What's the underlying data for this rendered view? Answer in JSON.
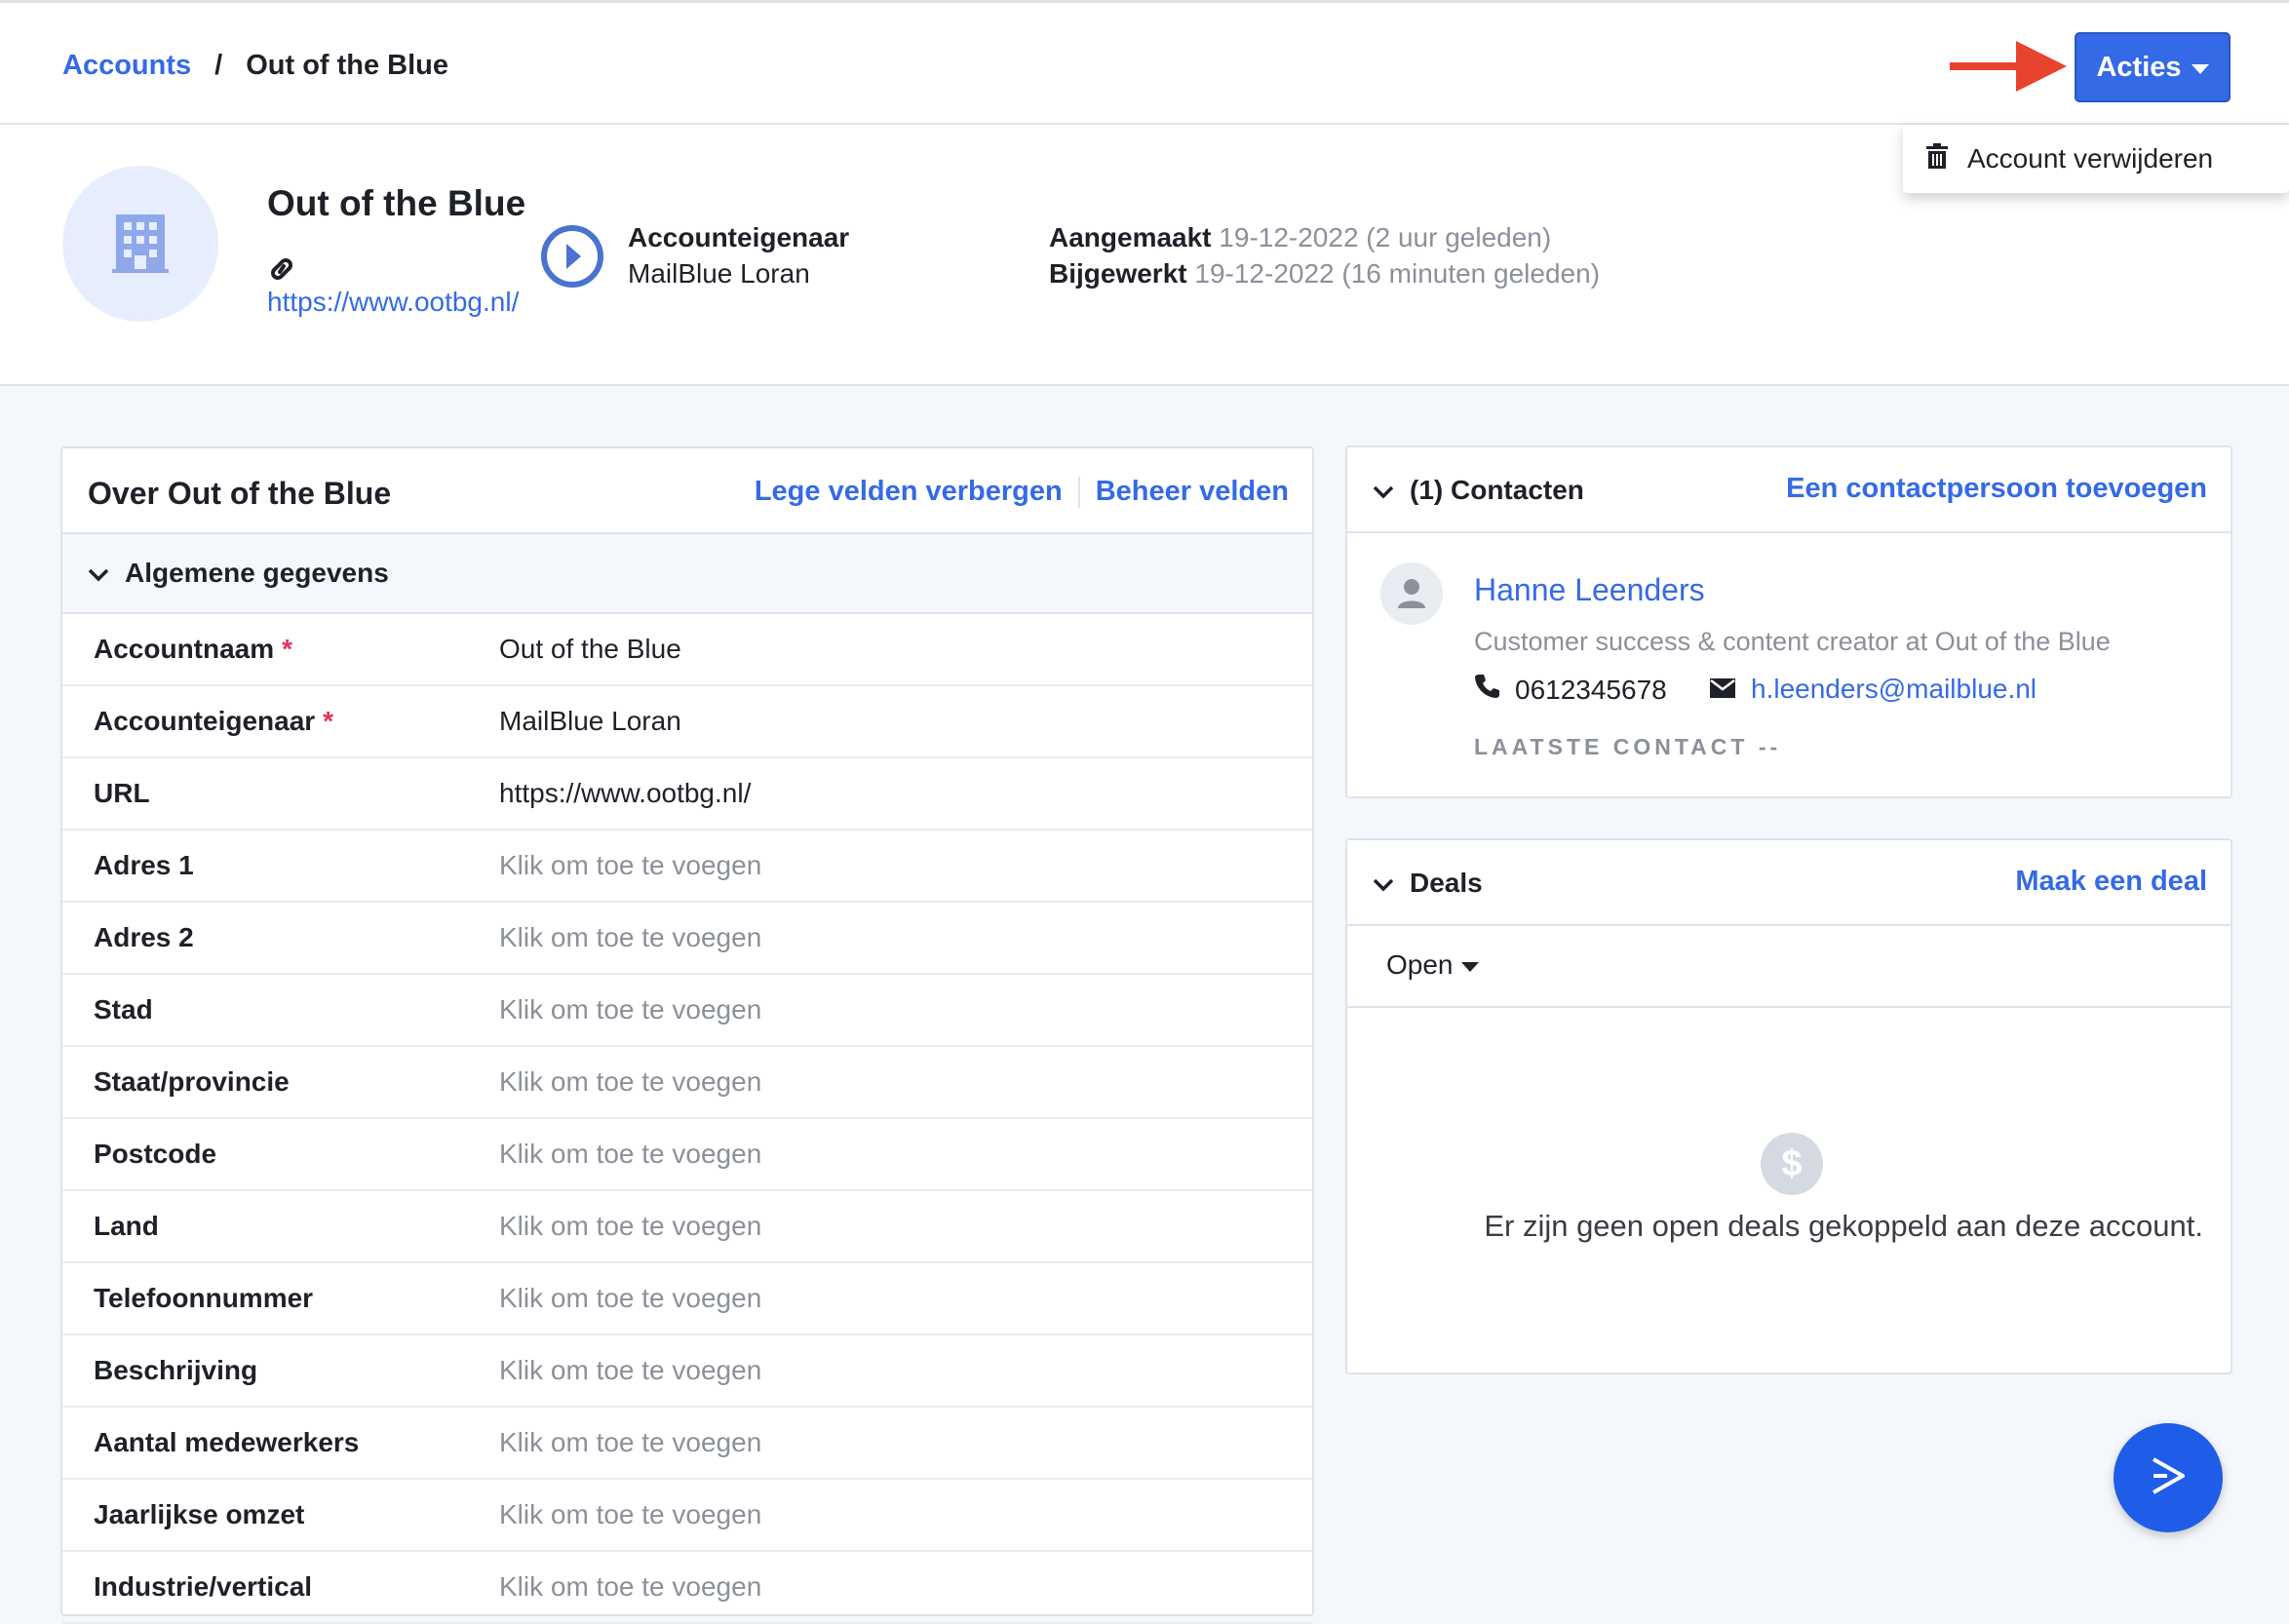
{
  "breadcrumb": {
    "parent": "Accounts",
    "separator": "/",
    "current": "Out of the Blue"
  },
  "actions": {
    "button_label": "Acties",
    "menu_items": [
      "Account verwijderen"
    ]
  },
  "account": {
    "name": "Out of the Blue",
    "url": "https://www.ootbg.nl/",
    "owner_label": "Accounteigenaar",
    "owner_value": "MailBlue Loran",
    "created_label": "Aangemaakt",
    "created_value": "19-12-2022 (2 uur geleden)",
    "updated_label": "Bijgewerkt",
    "updated_value": "19-12-2022 (16 minuten geleden)"
  },
  "about": {
    "title": "Over Out of the Blue",
    "hide_empty_label": "Lege velden verbergen",
    "manage_fields_label": "Beheer velden",
    "section_label": "Algemene gegevens",
    "fields": [
      {
        "label": "Accountnaam",
        "required": "*",
        "value": "Out of the Blue"
      },
      {
        "label": "Accounteigenaar",
        "required": "*",
        "value": "MailBlue Loran"
      },
      {
        "label": "URL",
        "required": "",
        "value": "https://www.ootbg.nl/"
      },
      {
        "label": "Adres 1",
        "required": "",
        "value": "Klik om toe te voegen"
      },
      {
        "label": "Adres 2",
        "required": "",
        "value": "Klik om toe te voegen"
      },
      {
        "label": "Stad",
        "required": "",
        "value": "Klik om toe te voegen"
      },
      {
        "label": "Staat/provincie",
        "required": "",
        "value": "Klik om toe te voegen"
      },
      {
        "label": "Postcode",
        "required": "",
        "value": "Klik om toe te voegen"
      },
      {
        "label": "Land",
        "required": "",
        "value": "Klik om toe te voegen"
      },
      {
        "label": "Telefoonnummer",
        "required": "",
        "value": "Klik om toe te voegen"
      },
      {
        "label": "Beschrijving",
        "required": "",
        "value": "Klik om toe te voegen"
      },
      {
        "label": "Aantal medewerkers",
        "required": "",
        "value": "Klik om toe te voegen"
      },
      {
        "label": "Jaarlijkse omzet",
        "required": "",
        "value": "Klik om toe te voegen"
      },
      {
        "label": "Industrie/vertical",
        "required": "",
        "value": "Klik om toe te voegen"
      }
    ]
  },
  "contacts": {
    "title": "(1) Contacten",
    "add_label": "Een contactpersoon toevoegen",
    "items": [
      {
        "name": "Hanne Leenders",
        "role": "Customer success & content creator at Out of the Blue",
        "phone": "0612345678",
        "email": "h.leenders@mailblue.nl",
        "last_contact": "LAATSTE CONTACT --"
      }
    ]
  },
  "deals": {
    "title": "Deals",
    "create_label": "Maak een deal",
    "filter_value": "Open",
    "empty_text": "Er zijn geen open deals gekoppeld aan deze account."
  },
  "colors": {
    "accent": "#356ae6",
    "arrow": "#e8432e",
    "fab": "#1f5de8",
    "required": "#e0335a"
  }
}
